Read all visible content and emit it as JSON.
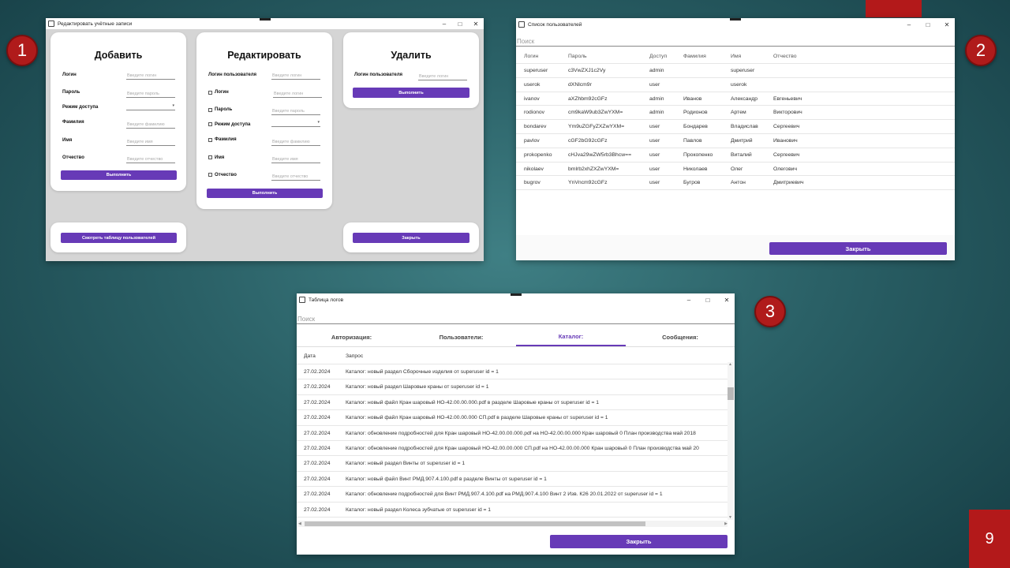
{
  "slide": {
    "page_number": "9",
    "badges": [
      "1",
      "2",
      "3"
    ]
  },
  "window1": {
    "title": "Редактировать учётные записи",
    "add": {
      "heading": "Добавить",
      "fields": [
        {
          "label": "Логин",
          "placeholder": "Введите логин"
        },
        {
          "label": "Пароль",
          "placeholder": "Введите пароль"
        },
        {
          "label": "Режим доступа",
          "placeholder": ""
        },
        {
          "label": "Фамилия",
          "placeholder": "Введите фамилию"
        },
        {
          "label": "Имя",
          "placeholder": "Введите имя"
        },
        {
          "label": "Отчество",
          "placeholder": "Введите отчество"
        }
      ],
      "button": "Выполнить"
    },
    "edit": {
      "heading": "Редактировать",
      "login_label": "Логин пользователя",
      "login_placeholder": "Введите логин",
      "fields": [
        {
          "label": "Логин",
          "placeholder": "Введите логин"
        },
        {
          "label": "Пароль",
          "placeholder": "Введите пароль"
        },
        {
          "label": "Режим доступа",
          "placeholder": ""
        },
        {
          "label": "Фамилия",
          "placeholder": "Введите фамилию"
        },
        {
          "label": "Имя",
          "placeholder": "Введите имя"
        },
        {
          "label": "Отчество",
          "placeholder": "Введите отчество"
        }
      ],
      "button": "Выполнить"
    },
    "delete": {
      "heading": "Удалить",
      "login_label": "Логин пользователя",
      "login_placeholder": "Введите логин",
      "button": "Выполнить"
    },
    "view_table_button": "Смотреть таблицу пользователей",
    "close_button": "Закрыть"
  },
  "window2": {
    "title": "Список пользователей",
    "search_placeholder": "Поиск",
    "columns": [
      "Логин",
      "Пароль",
      "Доступ",
      "Фамилия",
      "Имя",
      "Отчество"
    ],
    "rows": [
      [
        "superuser",
        "c3VwZXJ1c2Vy",
        "admin",
        "",
        "superuser",
        ""
      ],
      [
        "userok",
        "dXNlcm9r",
        "user",
        "",
        "userok",
        ""
      ],
      [
        "ivanov",
        "aXZhbm92cGFz",
        "admin",
        "Иванов",
        "Александр",
        "Евгеньевич"
      ],
      [
        "rodionov",
        "cm9kaW9ub3ZwYXM=",
        "admin",
        "Родионов",
        "Артем",
        "Викторович"
      ],
      [
        "bondarev",
        "Ym9uZGFyZXZwYXM=",
        "user",
        "Бондарев",
        "Владислав",
        "Сергеевич"
      ],
      [
        "pavlov",
        "cGF2bG92cGFz",
        "user",
        "Павлов",
        "Дмитрий",
        "Иванович"
      ],
      [
        "prokopenko",
        "cHJva29wZW5rb3Bhcw==",
        "user",
        "Прокопенко",
        "Виталий",
        "Сергеевич"
      ],
      [
        "nikolaev",
        "bmlrb2xhZXZwYXM=",
        "user",
        "Николаев",
        "Олег",
        "Олегович"
      ],
      [
        "bugrov",
        "YnVncm92cGFz",
        "user",
        "Бугров",
        "Антон",
        "Дмитриевич"
      ]
    ],
    "close_button": "Закрыть"
  },
  "window3": {
    "title": "Таблица логов",
    "search_placeholder": "Поиск",
    "tabs": [
      "Авторизация:",
      "Пользователи:",
      "Каталог:",
      "Сообщения:"
    ],
    "active_tab": "Каталог:",
    "columns": [
      "Дата",
      "Запрос"
    ],
    "rows": [
      [
        "27.02.2024",
        "Каталог: новый раздел Сборочные изделия от superuser id = 1"
      ],
      [
        "27.02.2024",
        "Каталог: новый раздел Шаровые краны от superuser id = 1"
      ],
      [
        "27.02.2024",
        "Каталог: новый файл Кран шаровый НО-42.00.00.000.pdf в разделе Шаровые краны от superuser id = 1"
      ],
      [
        "27.02.2024",
        "Каталог: новый файл Кран шаровый НО-42.00.00.000 СП.pdf в разделе Шаровые краны от superuser id = 1"
      ],
      [
        "27.02.2024",
        "Каталог: обновление подробностей для  Кран шаровый НО-42.00.00.000.pdf на НО-42.00.00.000 Кран шаровый 0 План производства май 2018"
      ],
      [
        "27.02.2024",
        "Каталог: обновление подробностей для  Кран шаровый НО-42.00.00.000 СП.pdf на НО-42.00.00.000 Кран шаровый 0 План производства май 20"
      ],
      [
        "27.02.2024",
        "Каталог: новый раздел Винты от superuser id = 1"
      ],
      [
        "27.02.2024",
        "Каталог: новый файл Винт РМД.907.4.100.pdf в разделе Винты от superuser id = 1"
      ],
      [
        "27.02.2024",
        "Каталог: обновление подробностей для  Винт РМД.907.4.100.pdf на РМД.907.4.100 Винт 2 Изв. К26 20.01.2022 от superuser id = 1"
      ],
      [
        "27.02.2024",
        "Каталог: новый раздел Колеса зубчатые от superuser id = 1"
      ]
    ],
    "close_button": "Закрыть"
  },
  "colors": {
    "accent": "#673ab7",
    "badge": "#b01b1b",
    "slide_bar": "#b3191a"
  }
}
